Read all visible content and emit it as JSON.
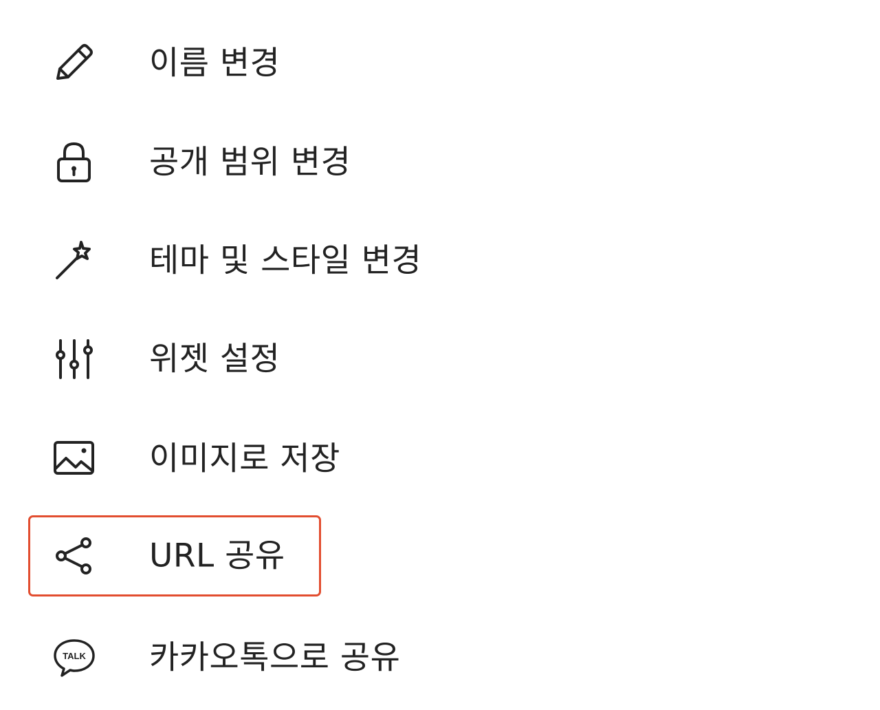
{
  "menu": {
    "items": [
      {
        "label": "이름 변경",
        "icon": "pencil-icon"
      },
      {
        "label": "공개 범위 변경",
        "icon": "lock-icon"
      },
      {
        "label": "테마 및 스타일 변경",
        "icon": "magic-wand-icon"
      },
      {
        "label": "위젯 설정",
        "icon": "sliders-icon"
      },
      {
        "label": "이미지로 저장",
        "icon": "image-icon"
      },
      {
        "label": "URL 공유",
        "icon": "share-icon"
      },
      {
        "label": "카카오톡으로 공유",
        "icon": "kakaotalk-icon",
        "icon_text": "TALK"
      }
    ],
    "highlighted_item": "URL 공유",
    "colors": {
      "text": "#222222",
      "icon": "#222222",
      "highlight_border": "#e24d2f",
      "background": "#ffffff"
    }
  }
}
